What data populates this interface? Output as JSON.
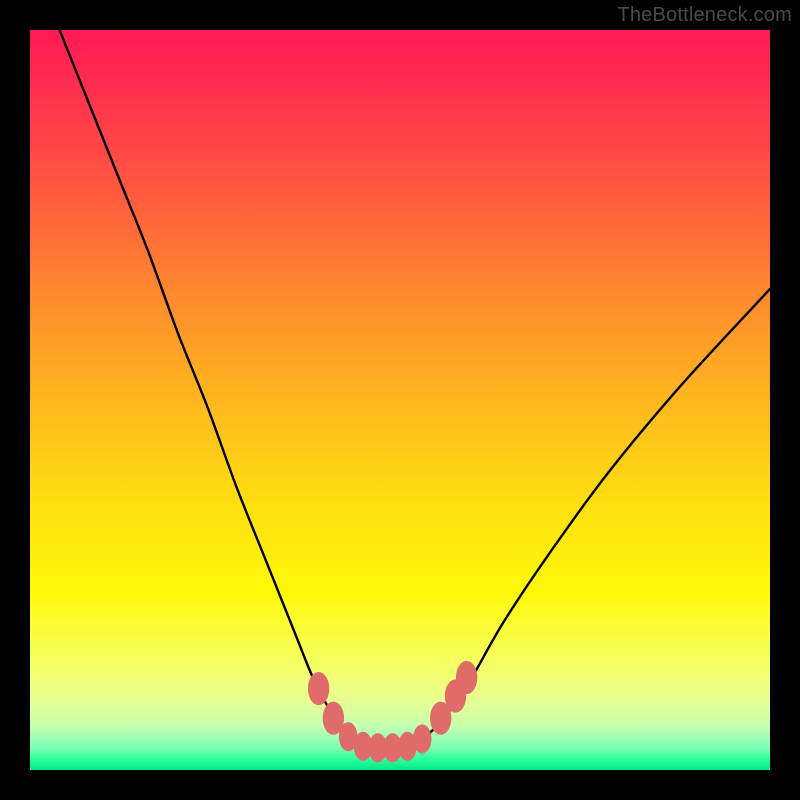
{
  "watermark": "TheBottleneck.com",
  "colors": {
    "frame": "#000000",
    "curve": "#000000",
    "marker": "#e06b6b",
    "gradient_top": "#ff1a55",
    "gradient_bottom": "#00e887"
  },
  "chart_data": {
    "type": "line",
    "title": "",
    "xlabel": "",
    "ylabel": "",
    "xlim": [
      0,
      100
    ],
    "ylim": [
      0,
      100
    ],
    "note": "Axes are unmarked; values are estimated positions in 0–100 space (y increases upward). The curve is a V-shaped bottleneck plot with its minimum near x≈47.",
    "series": [
      {
        "name": "bottleneck-curve",
        "x": [
          4,
          8,
          12,
          16,
          20,
          24,
          28,
          32,
          36,
          38,
          40,
          42,
          44,
          46,
          48,
          50,
          52,
          54,
          56,
          58,
          60,
          64,
          70,
          78,
          88,
          100
        ],
        "y": [
          100,
          90,
          80,
          70,
          59,
          49,
          38,
          28,
          18,
          13,
          9,
          6,
          4,
          3,
          3,
          3,
          3.5,
          5,
          7,
          10,
          13,
          20,
          29,
          40,
          52,
          65
        ]
      }
    ],
    "markers": {
      "name": "highlight-points",
      "points": [
        {
          "x": 39,
          "y": 11,
          "r": 1.6
        },
        {
          "x": 41,
          "y": 7,
          "r": 1.6
        },
        {
          "x": 43,
          "y": 4.5,
          "r": 1.4
        },
        {
          "x": 45,
          "y": 3.2,
          "r": 1.4
        },
        {
          "x": 47,
          "y": 3,
          "r": 1.4
        },
        {
          "x": 49,
          "y": 3,
          "r": 1.4
        },
        {
          "x": 51,
          "y": 3.2,
          "r": 1.4
        },
        {
          "x": 53,
          "y": 4.2,
          "r": 1.4
        },
        {
          "x": 55.5,
          "y": 7,
          "r": 1.6
        },
        {
          "x": 57.5,
          "y": 10,
          "r": 1.6
        },
        {
          "x": 59,
          "y": 12.5,
          "r": 1.6
        }
      ]
    }
  }
}
